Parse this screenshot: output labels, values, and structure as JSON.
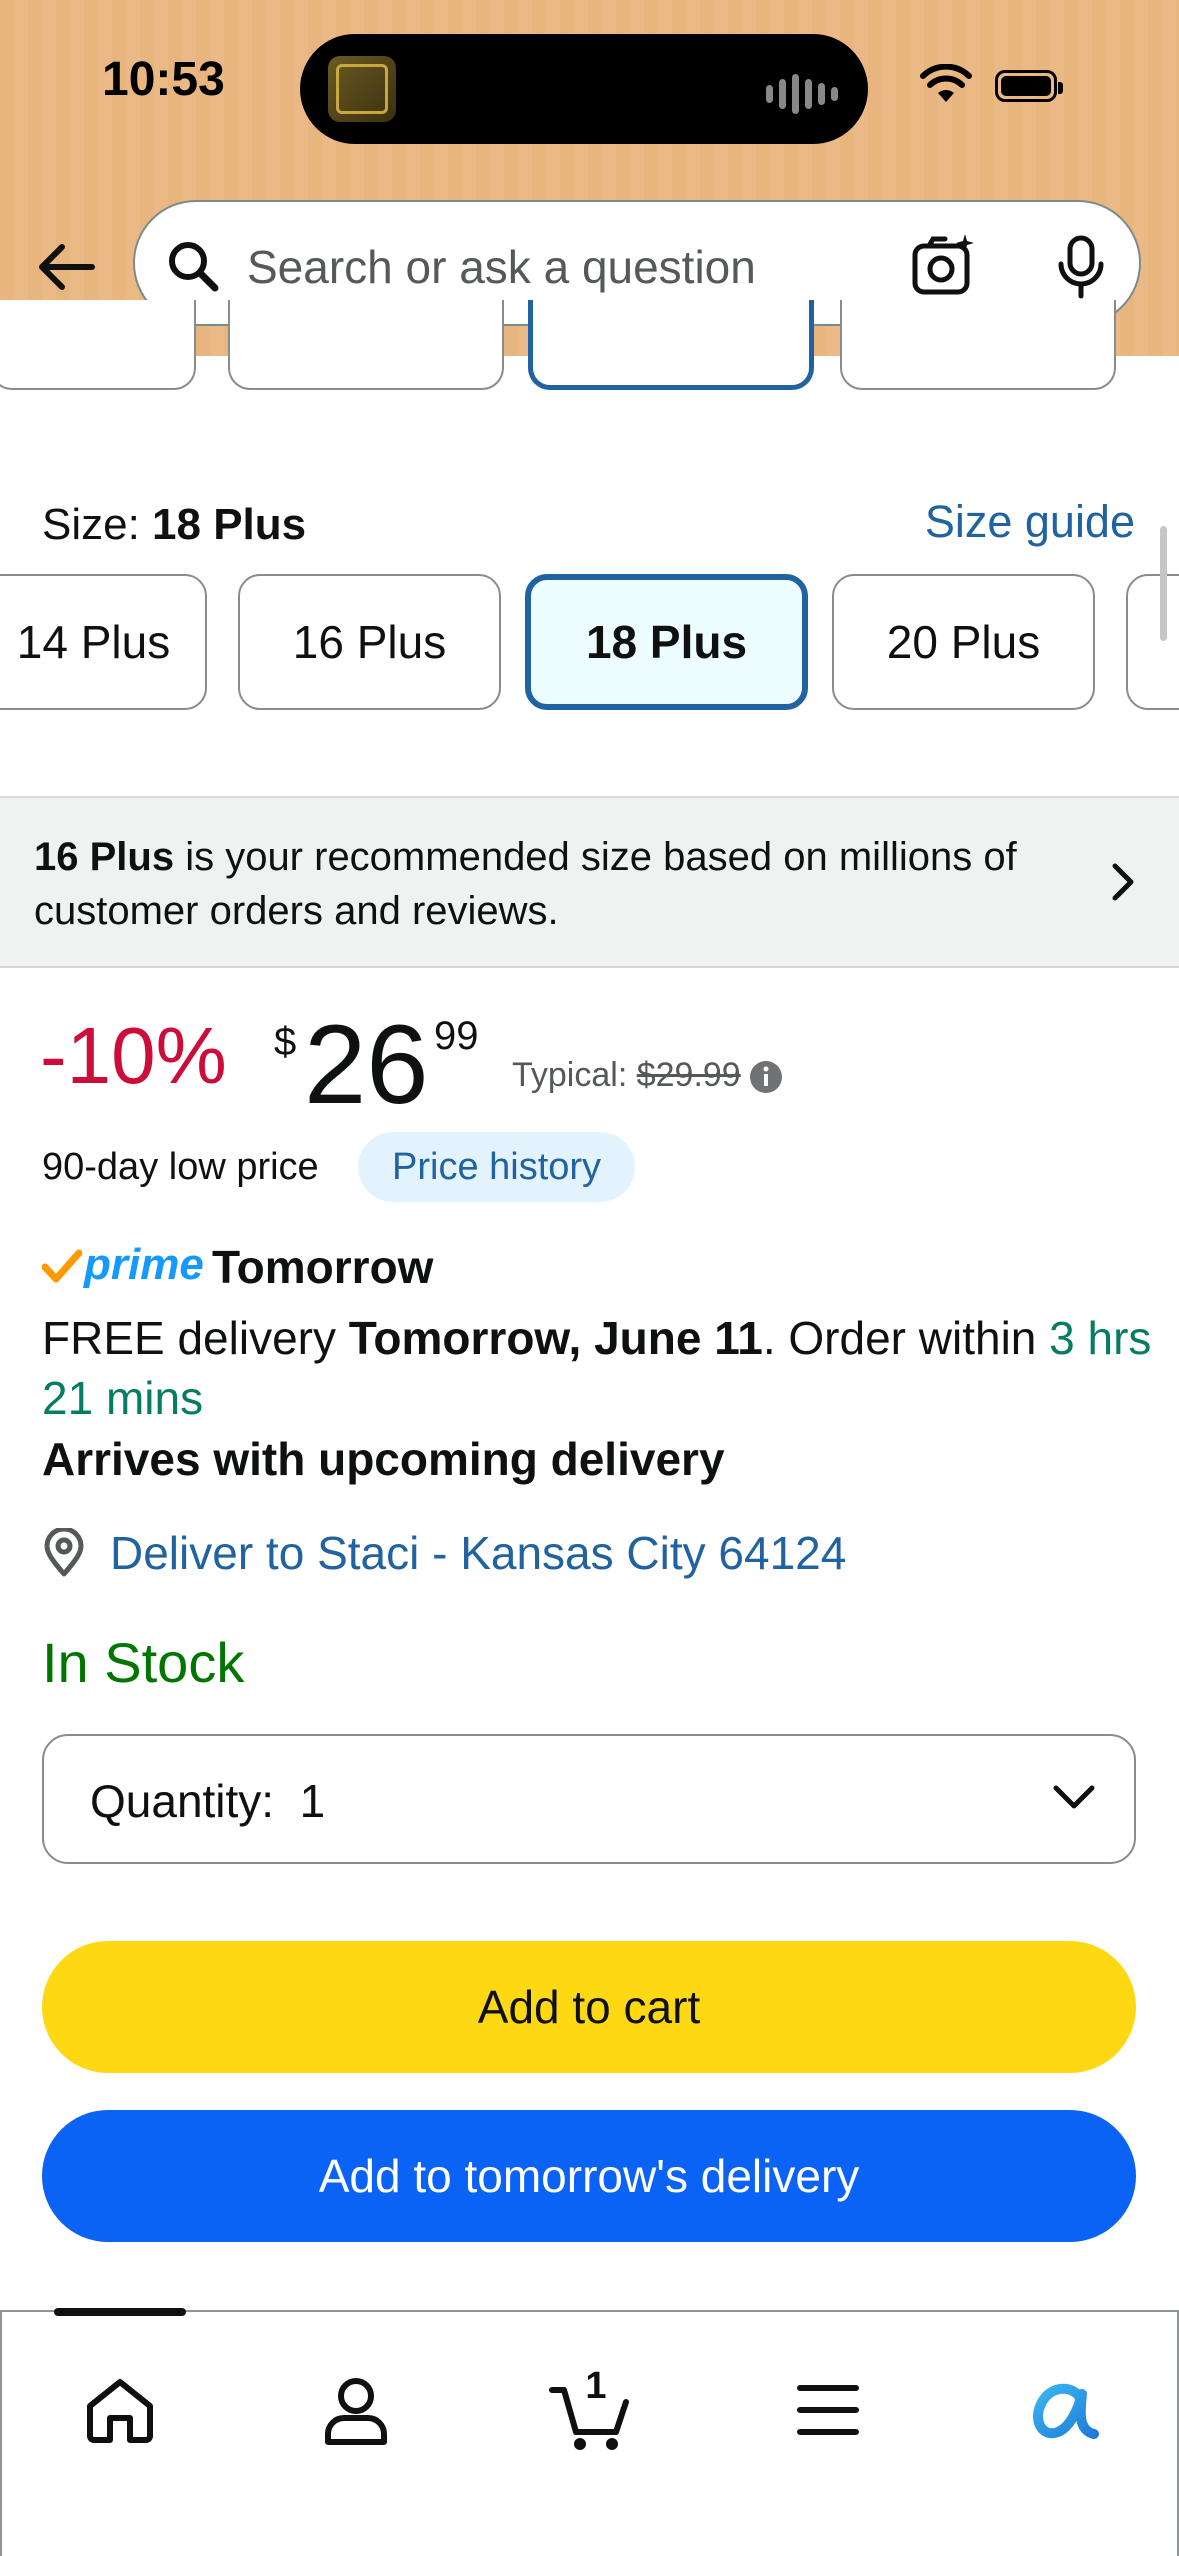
{
  "status_bar": {
    "time": "10:53"
  },
  "search": {
    "placeholder": "Search or ask a question"
  },
  "size": {
    "label": "Size: ",
    "selected": "18 Plus",
    "guide_link": "Size guide",
    "options": [
      "14 Plus",
      "16 Plus",
      "18 Plus",
      "20 Plus"
    ]
  },
  "recommendation": {
    "size": "16 Plus",
    "text": " is your recommended size based on millions of customer orders and reviews."
  },
  "price": {
    "discount": "-10%",
    "currency": "$",
    "whole": "26",
    "fraction": "99",
    "typical_label": "Typical: ",
    "typical_price": "$29.99",
    "low_price_label": "90-day low price",
    "history_button": "Price history"
  },
  "delivery": {
    "prime": "prime",
    "prime_day": "Tomorrow",
    "free_prefix": "FREE delivery ",
    "date": "Tomorrow, June 11",
    "order_within": ". Order within ",
    "countdown": "3 hrs 21 mins",
    "arrives": "Arrives with upcoming delivery",
    "deliver_to": "Deliver to Staci - Kansas City 64124"
  },
  "stock": "In Stock",
  "quantity": {
    "label": "Quantity:",
    "value": "1"
  },
  "buttons": {
    "add_to_cart": "Add to cart",
    "add_to_delivery": "Add to tomorrow's delivery"
  },
  "bottom_nav": {
    "cart_count": "1"
  },
  "colors": {
    "header_bg": "#e9b57f",
    "link_blue": "#2162a1",
    "discount_red": "#cc0c39",
    "stock_green": "#007600",
    "cart_yellow": "#ffd814",
    "delivery_blue": "#0b63f6"
  },
  "icons": [
    "back-arrow-icon",
    "search-icon",
    "camera-icon",
    "mic-icon",
    "chevron-right-icon",
    "info-icon",
    "location-pin-icon",
    "chevron-down-icon",
    "home-icon",
    "account-icon",
    "cart-icon",
    "menu-icon",
    "rufus-icon"
  ]
}
